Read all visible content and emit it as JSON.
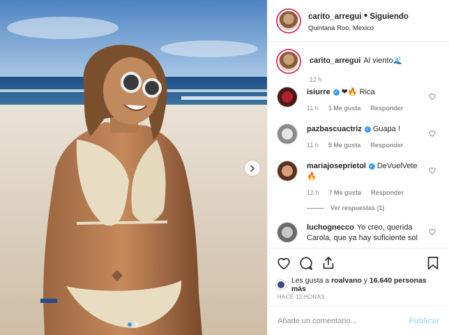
{
  "post": {
    "username": "carito_arregui",
    "separator": "•",
    "follow_status": "Siguiendo",
    "location": "Quintana Roo, Mexico",
    "carousel": {
      "slides": 2,
      "current": 1
    }
  },
  "caption": {
    "username": "carito_arregui",
    "text": "Al viento🌊",
    "time": "12 h"
  },
  "comments": [
    {
      "username": "isiurre",
      "verified": true,
      "text": "❤🔥 Rica",
      "time": "11 h",
      "likes": "1 Me gusta",
      "reply": "Responder"
    },
    {
      "username": "pazbascuactriz",
      "verified": true,
      "text": "Guapa !",
      "time": "11 h",
      "likes": "5 Me gusta",
      "reply": "Responder"
    },
    {
      "username": "mariajoseprietol",
      "verified": true,
      "text": "DeVuelVete 🔥",
      "time": "12 h",
      "likes": "7 Me gusta",
      "reply": "Responder",
      "view_replies": "Ver respuestas (1)"
    },
    {
      "username": "luchognecco",
      "verified": false,
      "text": "Yo creo, querida Carola, que ya hay suficiente sol"
    }
  ],
  "likes_summary": {
    "prefix": "Les gusta a",
    "user": "roalvano",
    "middle": "y",
    "count": "16.640 personas más"
  },
  "time_ago": "HACE 12 HORAS",
  "add_comment": {
    "placeholder": "Añade un comentario...",
    "post_label": "Publicar"
  },
  "icons": [
    "heart-icon",
    "comment-icon",
    "share-icon",
    "bookmark-icon",
    "chevron-right-icon"
  ]
}
